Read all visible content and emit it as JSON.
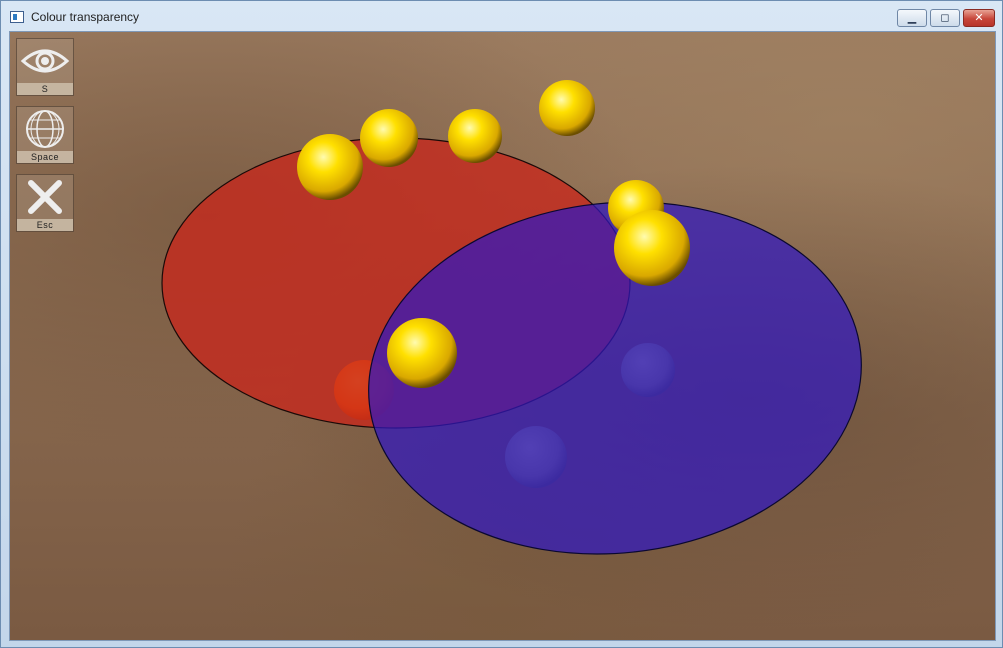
{
  "window": {
    "title": "Colour transparency",
    "min_glyph": "▁",
    "max_glyph": "◻",
    "close_glyph": "✕"
  },
  "toolbar": {
    "items": [
      {
        "icon": "eye-icon",
        "key": "S"
      },
      {
        "icon": "globe-wireframe-icon",
        "key": "Space"
      },
      {
        "icon": "close-x-icon",
        "key": "Esc"
      }
    ]
  },
  "scene": {
    "colors": {
      "red_disc": "#c8281c",
      "blue_disc": "#3018c0",
      "sphere": "#ffd700",
      "orange_sphere": "#ff6a00",
      "gray_sphere": "#8a8a78"
    }
  }
}
